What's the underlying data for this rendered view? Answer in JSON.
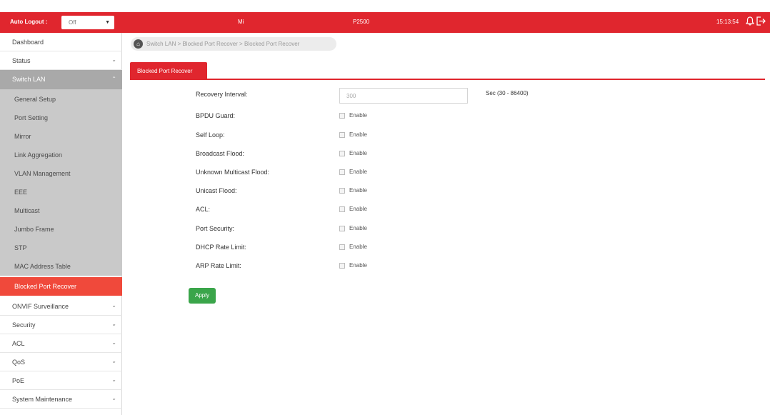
{
  "header": {
    "auto_logout_label": "Auto Logout :",
    "auto_logout_value": "Off",
    "center_text_1": "Mi",
    "center_text_2": "P2500",
    "time": "15:13:54"
  },
  "sidebar": {
    "items_top": [
      {
        "label": "Dashboard"
      },
      {
        "label": "Status"
      }
    ],
    "switch_lan": {
      "label": "Switch LAN",
      "children": [
        {
          "label": "General Setup"
        },
        {
          "label": "Port Setting"
        },
        {
          "label": "Mirror"
        },
        {
          "label": "Link Aggregation"
        },
        {
          "label": "VLAN Management"
        },
        {
          "label": "EEE"
        },
        {
          "label": "Multicast"
        },
        {
          "label": "Jumbo Frame"
        },
        {
          "label": "STP"
        },
        {
          "label": "MAC Address Table"
        },
        {
          "label": "Blocked Port Recover"
        }
      ]
    },
    "items_bottom": [
      {
        "label": "ONVIF Surveillance"
      },
      {
        "label": "Security"
      },
      {
        "label": "ACL"
      },
      {
        "label": "QoS"
      },
      {
        "label": "PoE"
      },
      {
        "label": "System Maintenance"
      }
    ]
  },
  "breadcrumb": "Switch LAN > Blocked Port Recover > Blocked Port Recover",
  "tab": "Blocked Port Recover",
  "form": {
    "interval_label": "Recovery Interval:",
    "interval_value": "300",
    "interval_hint": "Sec (30 - 86400)",
    "checkbox_text": "Enable",
    "rows": [
      {
        "label": "BPDU Guard:"
      },
      {
        "label": "Self Loop:"
      },
      {
        "label": "Broadcast Flood:"
      },
      {
        "label": "Unknown Multicast Flood:"
      },
      {
        "label": "Unicast Flood:"
      },
      {
        "label": "ACL:"
      },
      {
        "label": "Port Security:"
      },
      {
        "label": "DHCP Rate Limit:"
      },
      {
        "label": "ARP Rate Limit:"
      }
    ],
    "apply_label": "Apply"
  },
  "colors": {
    "brand_red": "#e0262e",
    "active_item": "#f0493b",
    "apply_green": "#3aa54a"
  }
}
